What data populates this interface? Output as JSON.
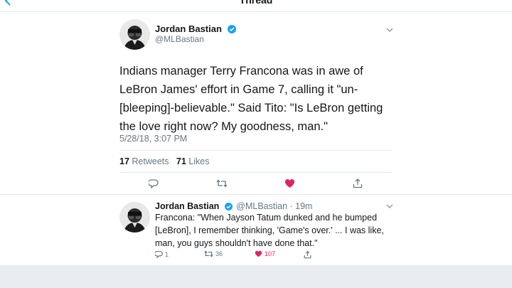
{
  "nav": {
    "title": "Thread"
  },
  "main_tweet": {
    "author_name": "Jordan Bastian",
    "handle": "@MLBastian",
    "text": "Indians manager Terry Francona was in awe of LeBron James' effort in Game 7, calling it \"un-[bleeping]-believable.\" Said Tito: \"Is LeBron getting the love right now? My goodness, man.\"",
    "timestamp": "5/28/18, 3:07 PM",
    "retweet_count": "17",
    "retweet_label": "Retweets",
    "like_count": "71",
    "like_label": "Likes"
  },
  "reply_tweet": {
    "author_name": "Jordan Bastian",
    "meta": "@MLBastian · 19m",
    "text": "Francona: \"When Jayson Tatum dunked and he bumped [LeBron], I remember thinking, 'Game's over.' ... I was like, man, you guys shouldn't have done that.\"",
    "reply_count": "1",
    "retweet_count": "36",
    "like_count": "107"
  },
  "colors": {
    "accent": "#1da1f2",
    "like": "#e0245e",
    "secondary_text": "#657786",
    "bottom_bar": "#e9edf1"
  },
  "icons": [
    "back-chevron-icon",
    "verified-badge-icon",
    "caret-down-icon",
    "reply-icon",
    "retweet-icon",
    "like-heart-icon",
    "share-icon"
  ]
}
